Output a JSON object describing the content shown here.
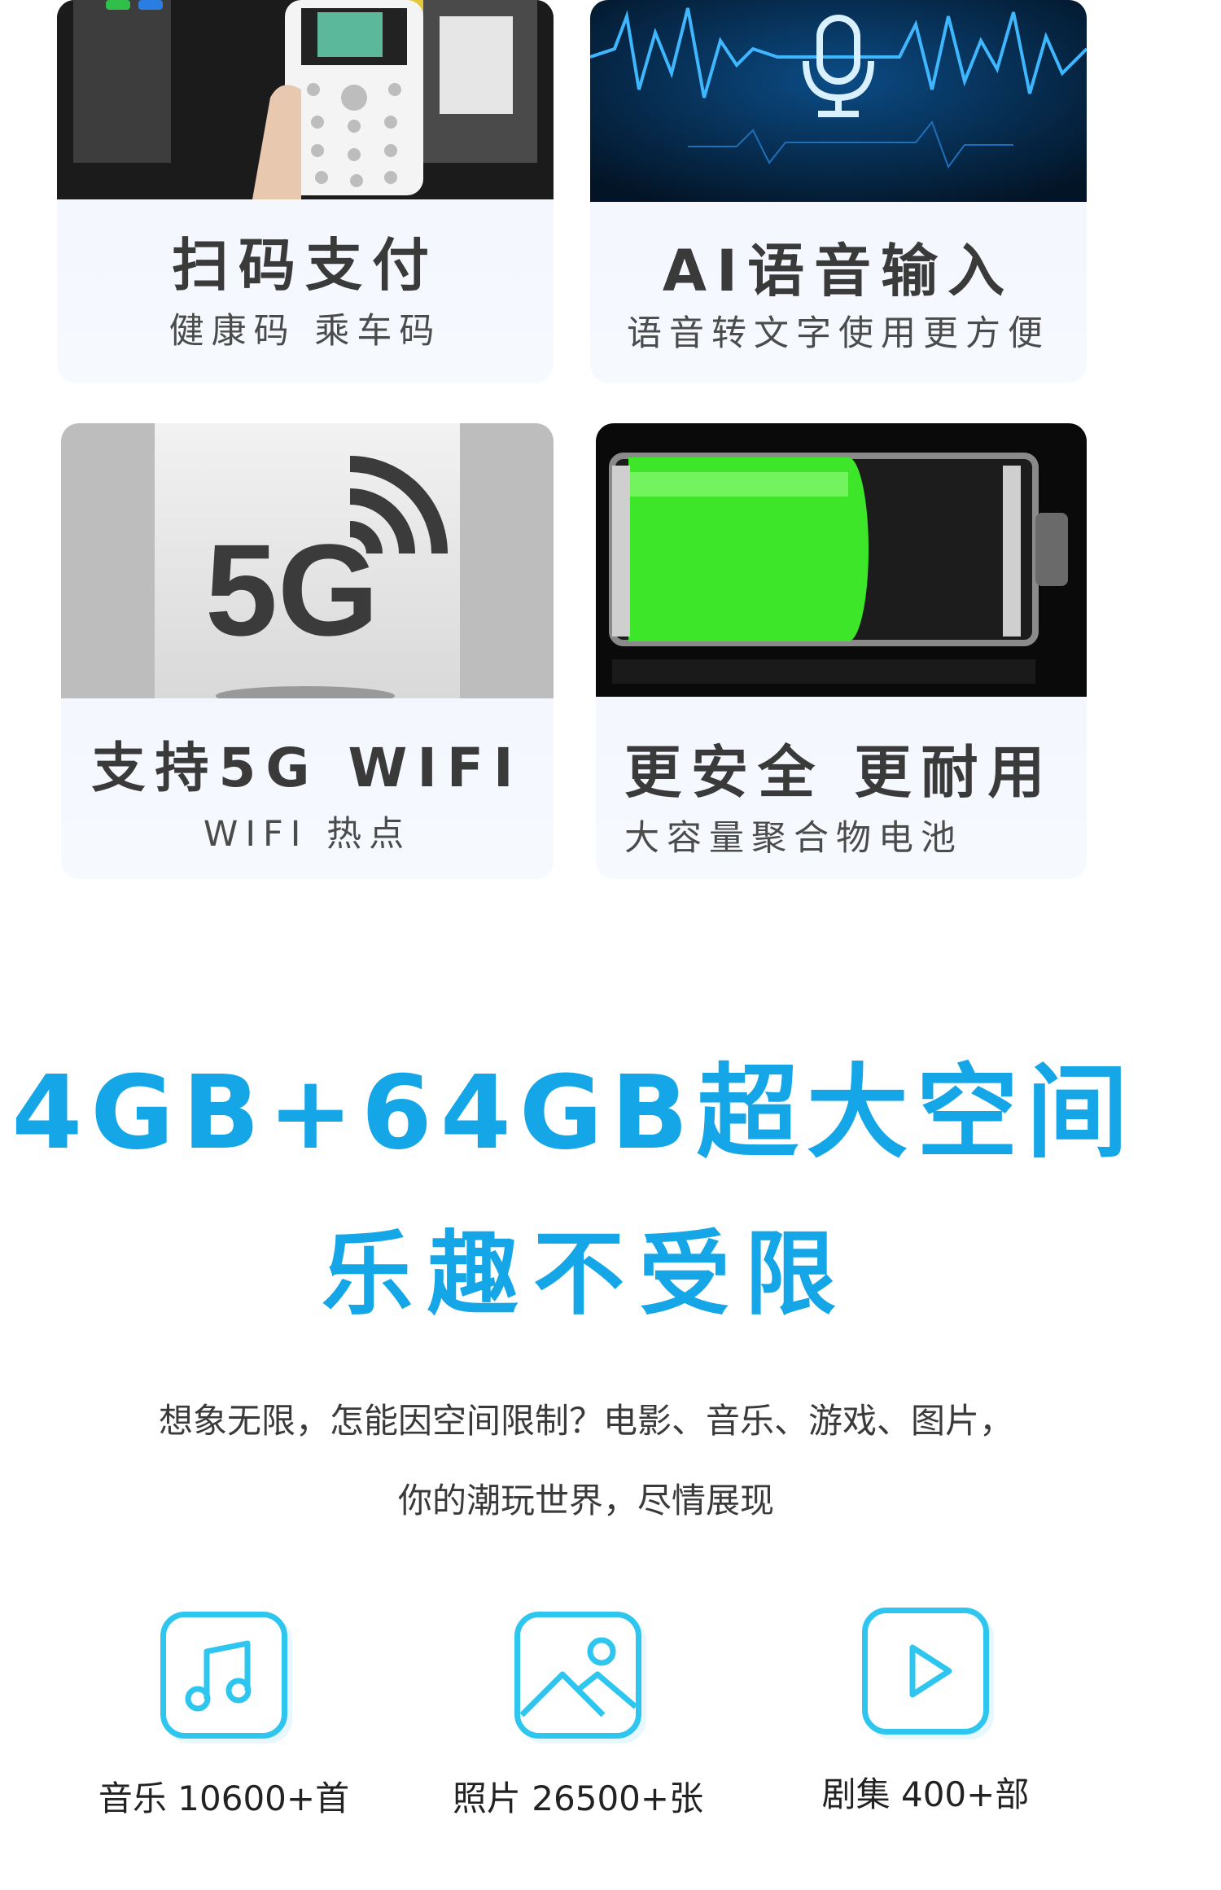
{
  "cards": [
    {
      "title": "扫码支付",
      "subtitle": "健康码 乘车码",
      "image_icon": "phone-qr-scan-photo"
    },
    {
      "title": "AI语音输入",
      "subtitle": "语音转文字使用更方便",
      "image_icon": "microphone-soundwave-photo"
    },
    {
      "title": "支持5G WIFI",
      "subtitle": "WIFI 热点",
      "image_icon": "5g-signal-photo",
      "image_text": "5G"
    },
    {
      "title": "更安全 更耐用",
      "subtitle": "大容量聚合物电池",
      "image_icon": "battery-photo"
    }
  ],
  "storage": {
    "headline": "4GB+64GB超大空间",
    "tagline": "乐趣不受限",
    "desc_line1": "想象无限，怎能因空间限制？电影、音乐、游戏、图片，",
    "desc_line2": "你的潮玩世界，尽情展现"
  },
  "features": [
    {
      "icon": "music-note-icon",
      "label": "音乐 10600+首"
    },
    {
      "icon": "image-icon",
      "label": "照片 26500+张"
    },
    {
      "icon": "play-icon",
      "label": "剧集 400+部"
    }
  ],
  "colors": {
    "accent": "#14a6e6",
    "icon_border": "#2ec6ee",
    "card_bg": "#f3f7fd",
    "battery_green": "#3ee62a"
  }
}
